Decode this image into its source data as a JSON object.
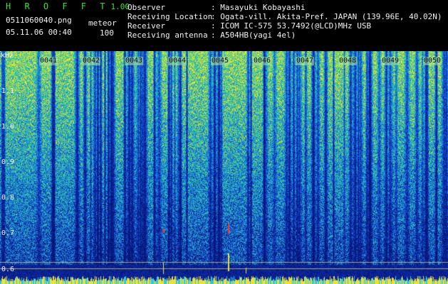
{
  "header": {
    "app_name": "H R O F F T",
    "version": "1.00",
    "filename": "0511060040.png",
    "datetime": "05.11.06 00:40",
    "mode_label": "meteor",
    "count": "100",
    "info_labels": [
      "Observer",
      "Receiving Location",
      "Receiver",
      "Receiving antenna"
    ],
    "info_values": [
      ": Masayuki Kobayashi",
      ": Ogata-vill. Akita-Pref. JAPAN (139.96E, 40.02N)",
      ": ICOM IC-575 53.7492(@LCD)MHz USB",
      ": A504HB(yagi 4el)"
    ]
  },
  "axis": {
    "unit": "kHz",
    "tick_labels": [
      "1.1",
      "1.0",
      "0.9",
      "0.8",
      "0.7",
      "0.6"
    ]
  },
  "time_labels": [
    "0041",
    "0042",
    "0043",
    "0044",
    "0045",
    "0046",
    "0047",
    "0048",
    "0049",
    "0050"
  ],
  "colors": {
    "background": "#000000",
    "header_text": "#33e633",
    "info_text": "#f2f2f2",
    "spectrum_low": "#0a2a8c",
    "spectrum_mid": "#1f6fd6",
    "spectrum_high": "#2fc8a0",
    "spectrum_peak": "#e8e23a",
    "meteor_trace": "#ff3030"
  }
}
